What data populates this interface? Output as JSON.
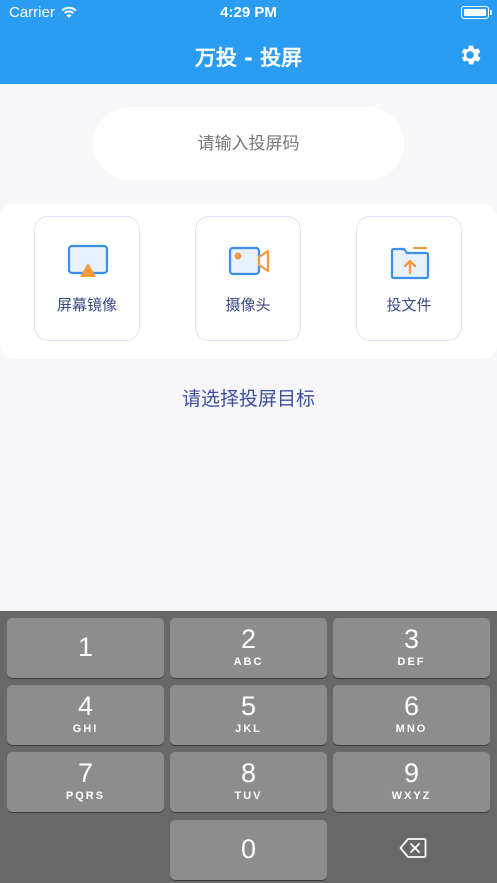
{
  "status_bar": {
    "carrier": "Carrier",
    "time": "4:29 PM"
  },
  "nav": {
    "title": "万投 - 投屏",
    "settings_icon": "gear-icon"
  },
  "code_input": {
    "placeholder": "请输入投屏码",
    "value": ""
  },
  "options": [
    {
      "label": "屏幕镜像",
      "icon": "screen-mirror-icon"
    },
    {
      "label": "摄像头",
      "icon": "camera-icon"
    },
    {
      "label": "投文件",
      "icon": "file-upload-icon"
    }
  ],
  "target_hint": "请选择投屏目标",
  "keypad": {
    "keys": [
      {
        "digit": "1",
        "letters": ""
      },
      {
        "digit": "2",
        "letters": "ABC"
      },
      {
        "digit": "3",
        "letters": "DEF"
      },
      {
        "digit": "4",
        "letters": "GHI"
      },
      {
        "digit": "5",
        "letters": "JKL"
      },
      {
        "digit": "6",
        "letters": "MNO"
      },
      {
        "digit": "7",
        "letters": "PQRS"
      },
      {
        "digit": "8",
        "letters": "TUV"
      },
      {
        "digit": "9",
        "letters": "WXYZ"
      },
      {
        "digit": "0",
        "letters": ""
      }
    ],
    "delete_icon": "backspace-icon"
  },
  "colors": {
    "header": "#2a9df3",
    "accent_text": "#3d4fa0",
    "keypad_bg": "#686868",
    "key_bg": "#8d8d8d"
  }
}
